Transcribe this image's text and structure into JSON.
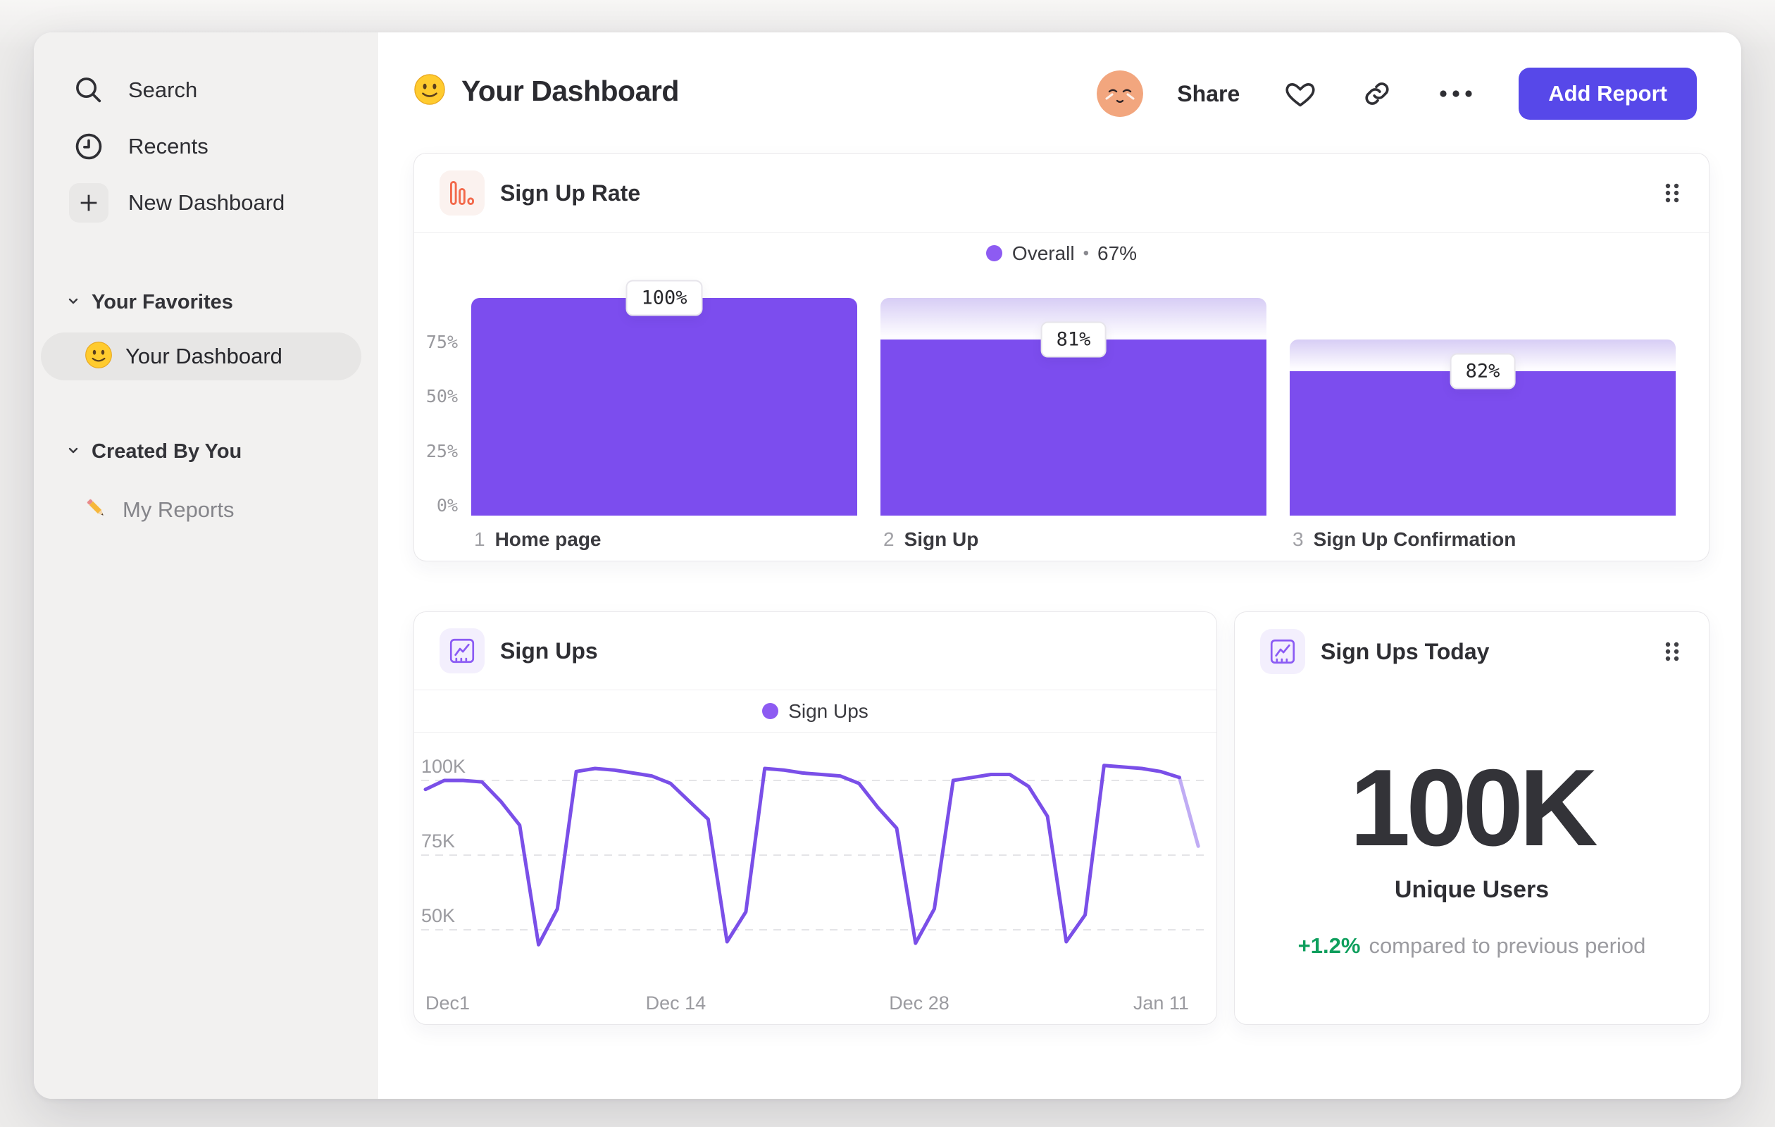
{
  "sidebar": {
    "items": [
      {
        "label": "Search"
      },
      {
        "label": "Recents"
      },
      {
        "label": "New Dashboard"
      }
    ],
    "sections": [
      {
        "header": "Your Favorites",
        "items": [
          {
            "label": "Your Dashboard",
            "active": true
          }
        ]
      },
      {
        "header": "Created By You",
        "items": [
          {
            "label": "My Reports",
            "active": false
          }
        ]
      }
    ]
  },
  "header": {
    "title": "Your Dashboard",
    "share_label": "Share",
    "add_report_label": "Add Report"
  },
  "cards": {
    "signup_rate": {
      "title": "Sign Up Rate"
    },
    "sign_ups": {
      "title": "Sign Ups"
    },
    "today": {
      "title": "Sign Ups Today",
      "value": "100K",
      "label": "Unique Users",
      "delta": "+1.2%",
      "delta_text": "compared to previous period"
    }
  },
  "chart_data": [
    {
      "type": "bar",
      "title": "Sign Up Rate",
      "legend": {
        "name": "Overall",
        "separator": "•",
        "value": "67%"
      },
      "yticks": [
        "75%",
        "50%",
        "25%",
        "0%"
      ],
      "ylim": [
        0,
        100
      ],
      "steps": [
        {
          "num": "1",
          "label": "Home page",
          "value_label": "100%",
          "height_pct": 100,
          "prev_pct": 100
        },
        {
          "num": "2",
          "label": "Sign Up",
          "value_label": "81%",
          "height_pct": 81,
          "prev_pct": 100
        },
        {
          "num": "3",
          "label": "Sign Up Confirmation",
          "value_label": "82%",
          "height_pct": 66.4,
          "prev_pct": 81
        }
      ],
      "colors": {
        "bar": "#7C4DEE",
        "cap_top": "#D7CDF5"
      }
    },
    {
      "type": "line",
      "title": "Sign Ups",
      "legend": {
        "name": "Sign Ups"
      },
      "unit": "K",
      "yticks": [
        {
          "label": "100K",
          "value": 100
        },
        {
          "label": "75K",
          "value": 75
        },
        {
          "label": "50K",
          "value": 50
        }
      ],
      "x_ticks": [
        {
          "label": "Dec1",
          "frac": 0.0,
          "align": "left"
        },
        {
          "label": "Dec 14",
          "frac": 0.324,
          "align": "center"
        },
        {
          "label": "Dec 28",
          "frac": 0.639,
          "align": "center"
        },
        {
          "label": "Jan 11",
          "frac": 0.952,
          "align": "center"
        }
      ],
      "series": [
        {
          "name": "Sign Ups",
          "values": [
            97,
            100,
            100,
            99.5,
            93,
            85,
            45,
            57,
            103,
            104,
            103.5,
            102.5,
            101.5,
            99,
            93,
            87,
            46,
            56,
            104,
            103.5,
            102.5,
            102,
            101.5,
            99,
            91,
            84,
            45.5,
            57,
            100,
            101,
            102,
            102,
            98,
            88,
            46,
            55,
            105,
            104.5,
            104,
            103,
            101,
            78
          ],
          "projected_last_n": 1
        }
      ],
      "colors": {
        "line": "#7A4FE8",
        "line_light": "#C0ACF4",
        "grid": "#E4E4E7"
      }
    }
  ]
}
